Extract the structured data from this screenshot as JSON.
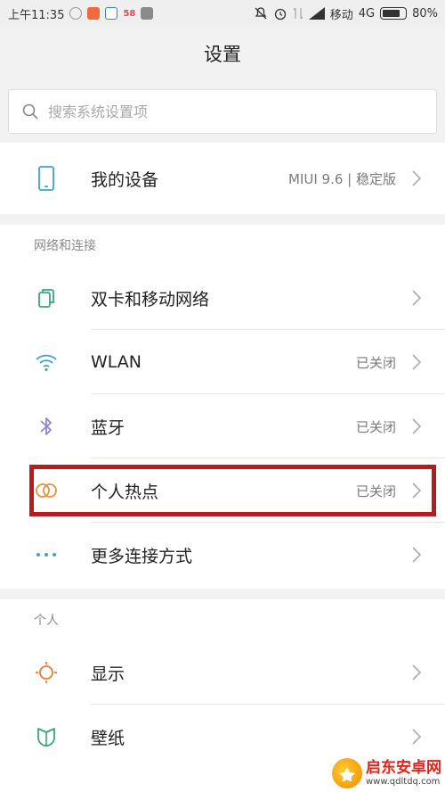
{
  "status_bar": {
    "time": "上午11:35",
    "carrier": "移动",
    "network": "4G",
    "battery": "80%",
    "app_badge": "58"
  },
  "header": {
    "title": "设置"
  },
  "search": {
    "placeholder": "搜索系统设置项"
  },
  "device": {
    "label": "我的设备",
    "value": "MIUI 9.6 | 稳定版"
  },
  "network_section": {
    "title": "网络和连接",
    "items": [
      {
        "label": "双卡和移动网络",
        "value": "",
        "icon": "sim-card-icon"
      },
      {
        "label": "WLAN",
        "value": "已关闭",
        "icon": "wifi-icon"
      },
      {
        "label": "蓝牙",
        "value": "已关闭",
        "icon": "bluetooth-icon"
      },
      {
        "label": "个人热点",
        "value": "已关闭",
        "icon": "hotspot-icon"
      },
      {
        "label": "更多连接方式",
        "value": "",
        "icon": "more-dots-icon"
      }
    ]
  },
  "personal_section": {
    "title": "个人",
    "items": [
      {
        "label": "显示",
        "icon": "display-icon"
      },
      {
        "label": "壁纸",
        "icon": "wallpaper-icon"
      }
    ]
  },
  "watermark": {
    "title": "启东安卓网",
    "url": "www.qdltdq.com"
  },
  "colors": {
    "accent_teal": "#3aa6a6",
    "highlight": "#b71c1c",
    "sun_orange": "#ef7a33"
  }
}
